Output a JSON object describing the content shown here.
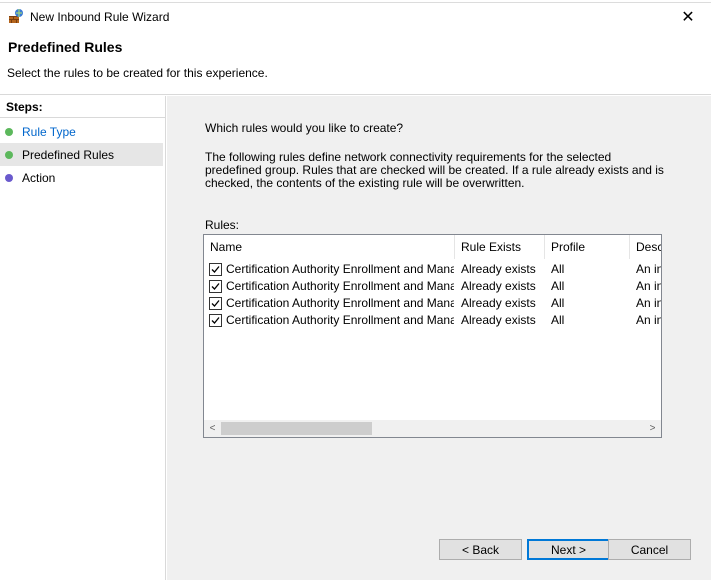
{
  "window": {
    "title": "New Inbound Rule Wizard",
    "close_glyph": "✕"
  },
  "header": {
    "heading": "Predefined Rules",
    "subtitle": "Select the rules to be created for this experience."
  },
  "steps": {
    "title": "Steps:",
    "items": [
      {
        "label": "Rule Type",
        "color": "#0066cc",
        "dot": "#5cb85c"
      },
      {
        "label": "Predefined Rules",
        "color": "#000000",
        "dot": "#5cb85c"
      },
      {
        "label": "Action",
        "color": "#000000",
        "dot": "#6a5acd"
      }
    ]
  },
  "content": {
    "question": "Which rules would you like to create?",
    "description": "The following rules define network connectivity requirements for the selected predefined group. Rules that are checked will be created. If a rule already exists and is checked, the contents of the existing rule will be overwritten.",
    "rules_label": "Rules:"
  },
  "grid": {
    "columns": [
      "Name",
      "Rule Exists",
      "Profile",
      "Desc"
    ],
    "rows": [
      {
        "checked": true,
        "name": "Certification Authority Enrollment and Manage...",
        "exists": "Already exists",
        "profile": "All",
        "desc": "An in"
      },
      {
        "checked": true,
        "name": "Certification Authority Enrollment and Manage...",
        "exists": "Already exists",
        "profile": "All",
        "desc": "An in"
      },
      {
        "checked": true,
        "name": "Certification Authority Enrollment and Manage...",
        "exists": "Already exists",
        "profile": "All",
        "desc": "An in"
      },
      {
        "checked": true,
        "name": "Certification Authority Enrollment and Manage...",
        "exists": "Already exists",
        "profile": "All",
        "desc": "An in"
      }
    ],
    "scroll_left_glyph": "<",
    "scroll_right_glyph": ">"
  },
  "buttons": {
    "back": "< Back",
    "next": "Next >",
    "cancel": "Cancel"
  }
}
